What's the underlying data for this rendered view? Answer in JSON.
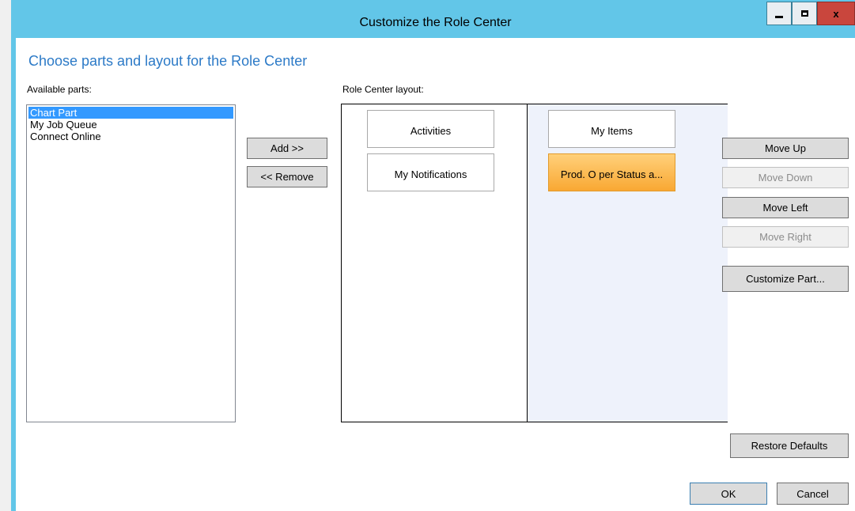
{
  "window": {
    "title": "Customize the Role Center",
    "close_glyph": "x"
  },
  "heading": "Choose parts and layout for the Role Center",
  "available_parts": {
    "label": "Available parts:",
    "items": [
      "Chart Part",
      "My Job Queue",
      "Connect Online"
    ],
    "selected_index": 0
  },
  "transfer": {
    "add_label": "Add >>",
    "remove_label": "<< Remove"
  },
  "layout": {
    "label": "Role Center layout:",
    "column1": [
      "Activities",
      "My Notifications"
    ],
    "column2": [
      "My Items",
      "Prod. O per Status a..."
    ],
    "selected_part": "Prod. O per Status a..."
  },
  "actions": {
    "move_up": "Move Up",
    "move_down": "Move Down",
    "move_left": "Move Left",
    "move_right": "Move Right",
    "customize_part": "Customize Part...",
    "restore_defaults": "Restore Defaults",
    "ok": "OK",
    "cancel": "Cancel"
  },
  "colors": {
    "titlebar": "#62c6e8",
    "heading": "#2c7ac7",
    "selection": "#3399ff",
    "selected_part": "#f9a833",
    "close_button": "#c9463d"
  }
}
